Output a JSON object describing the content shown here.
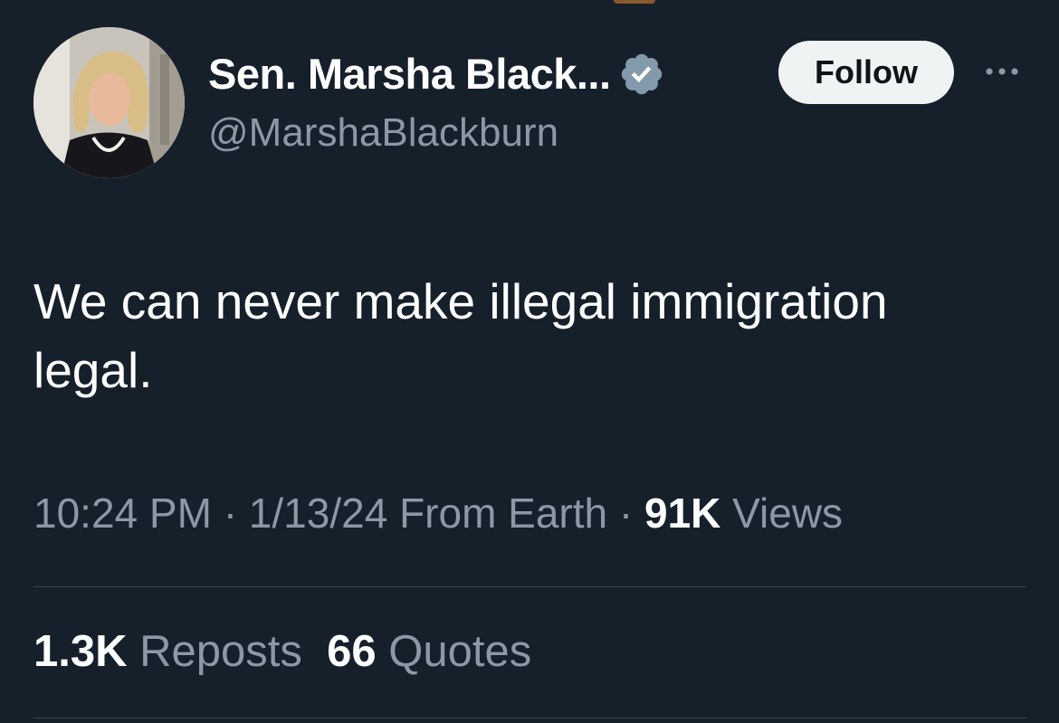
{
  "author": {
    "display_name": "Sen. Marsha Black...",
    "handle": "@MarshaBlackburn",
    "verified": true
  },
  "actions": {
    "follow_label": "Follow",
    "more_icon": "more-horizontal-icon"
  },
  "tweet": {
    "text_line1": "We can never make illegal immigration",
    "text_line2": "legal."
  },
  "meta": {
    "time": "10:24 PM",
    "sep1": "·",
    "date": "1/13/24",
    "source": "From Earth",
    "sep2": "·",
    "views_count": "91K",
    "views_label": "Views"
  },
  "stats": {
    "reposts_count": "1.3K",
    "reposts_label": "Reposts",
    "quotes_count": "66",
    "quotes_label": "Quotes"
  },
  "colors": {
    "background": "#15202b",
    "text_primary": "#ffffff",
    "text_secondary": "#8b98a5",
    "follow_bg": "#eff3f4",
    "verified_badge": "#829aab",
    "divider": "#38444d"
  }
}
